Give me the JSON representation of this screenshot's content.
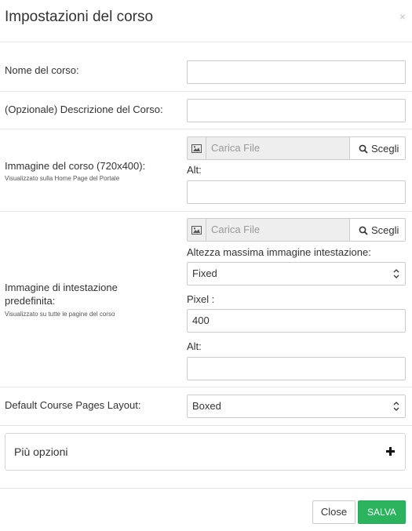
{
  "modal": {
    "title": "Impostazioni del corso",
    "close_symbol": "×"
  },
  "fields": {
    "course_name": {
      "label": "Nome del corso:",
      "value": ""
    },
    "description": {
      "label": "(Opzionale) Descrizione del Corso:",
      "value": ""
    },
    "course_image": {
      "label": "Immagine del corso (720x400):",
      "hint": "Visualizzato sulla Home Page del Portale",
      "file_placeholder": "Carica File",
      "choose_label": "Scegli",
      "alt_label": "Alt:",
      "alt_value": ""
    },
    "header_image": {
      "label": "Immagine di intestazione predefinita:",
      "hint": "Visualizzato su tutte le pagine del corso",
      "file_placeholder": "Carica File",
      "choose_label": "Scegli",
      "max_height_label": "Altezza massima immagine intestazione:",
      "max_height_value": "Fixed",
      "pixel_label": "Pixel :",
      "pixel_value": "400",
      "alt_label": "Alt:",
      "alt_value": ""
    },
    "layout": {
      "label": "Default Course Pages Layout:",
      "value": "Boxed"
    }
  },
  "more_options": {
    "label": "Più opzioni",
    "icon": "plus-icon"
  },
  "footer": {
    "close_label": "Close",
    "save_label": "SALVA"
  },
  "colors": {
    "save_button": "#2cb35e",
    "border": "#e5e5e5",
    "addon_bg": "#eeeeee"
  }
}
